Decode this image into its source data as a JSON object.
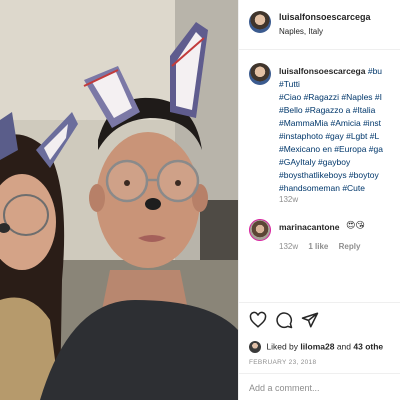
{
  "post": {
    "author": {
      "username": "luisalfonsoescarcega",
      "location": "Naples, Italy"
    },
    "caption": {
      "username": "luisalfonsoescarcega",
      "first_tag": "#bu",
      "lines": [
        "#Tutti",
        "#Ciao #Ragazzi #Naples #I",
        "#Bello #Ragazzo a #Italia",
        "#MammaMia #Amicia #inst",
        "#instaphoto #gay #Lgbt #L",
        "#Mexicano en #Europa #ga",
        "#GAyItaly #gayboy",
        "#boysthatlikeboys #boytoy",
        "#handsomeman #Cute"
      ],
      "time": "132w"
    },
    "comment": {
      "username": "marinacantone",
      "emoji": "😍😘",
      "time": "132w",
      "likes": "1 like",
      "reply": "Reply"
    },
    "likes": {
      "prefix": "Liked by",
      "user": "liloma28",
      "joiner": "and",
      "others": "43 othe"
    },
    "date": "FEBRUARY 23, 2018",
    "add_comment_placeholder": "Add a comment..."
  },
  "colors": {
    "hashtag": "#00376b",
    "muted": "#8e8e8e",
    "border": "#efefef",
    "story_ring": "#d6249f"
  },
  "icons": [
    "heart-icon",
    "comment-icon",
    "share-icon"
  ]
}
